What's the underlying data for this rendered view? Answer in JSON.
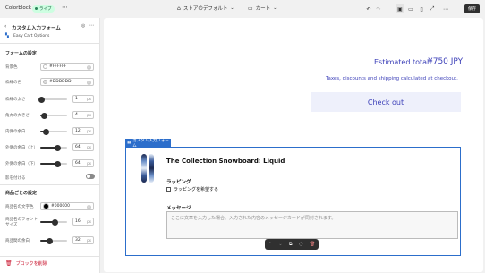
{
  "topbar": {
    "store_name": "Colorblock",
    "live_badge": "ライブ",
    "theme_select": "ストアのデフォルト",
    "page_select": "カート",
    "save_label": "保存"
  },
  "sidebar": {
    "title": "カスタム入力フォーム",
    "app_name": "Easy Cart Options",
    "form_section": "フォームの設定",
    "fields": [
      {
        "label": "背景色",
        "value": "#FFFFFF",
        "swatch": "#ffffff"
      },
      {
        "label": "枠線の色",
        "value": "#DDDDDD",
        "swatch": "#dddddd"
      }
    ],
    "sliders": [
      {
        "label": "枠線の太さ",
        "value": "1",
        "unit": "px",
        "level": 0.05
      },
      {
        "label": "角丸の大きさ",
        "value": "4",
        "unit": "px",
        "level": 0.15
      },
      {
        "label": "内側の余白",
        "value": "12",
        "unit": "px",
        "level": 0.2
      },
      {
        "label": "外側の余白（上）",
        "value": "64",
        "unit": "px",
        "level": 0.65
      },
      {
        "label": "外側の余白（下）",
        "value": "64",
        "unit": "px",
        "level": 0.65
      }
    ],
    "shadow_label": "影を付ける",
    "product_section": "商品ごとの設定",
    "product_color": {
      "label": "商品名の文字色",
      "value": "#000000",
      "swatch": "#000000"
    },
    "product_sliders": [
      {
        "label": "商品名のフォントサイズ",
        "value": "16",
        "unit": "px",
        "level": 0.55
      },
      {
        "label": "商品間の余白",
        "value": "32",
        "unit": "px",
        "level": 0.35
      }
    ],
    "delete_label": "ブロックを削除"
  },
  "preview": {
    "estimated_total_label": "Estimated total",
    "estimated_total_value": "¥750 JPY",
    "taxes_note": "Taxes, discounts and shipping calculated at checkout.",
    "checkout_label": "Check out",
    "block_tag": "カスタム入力フォーム",
    "product_title": "The Collection Snowboard: Liquid",
    "wrapping_heading": "ラッピング",
    "wrapping_option": "ラッピングを希望する",
    "message_heading": "メッセージ",
    "message_placeholder": "ここに文章を入力した場合、入力された内容のメッセージカードが同封されます。"
  },
  "colors": {
    "accent": "#3b3fb8",
    "checkout_bg": "#eef0fb",
    "selection": "#2c6ecb"
  }
}
